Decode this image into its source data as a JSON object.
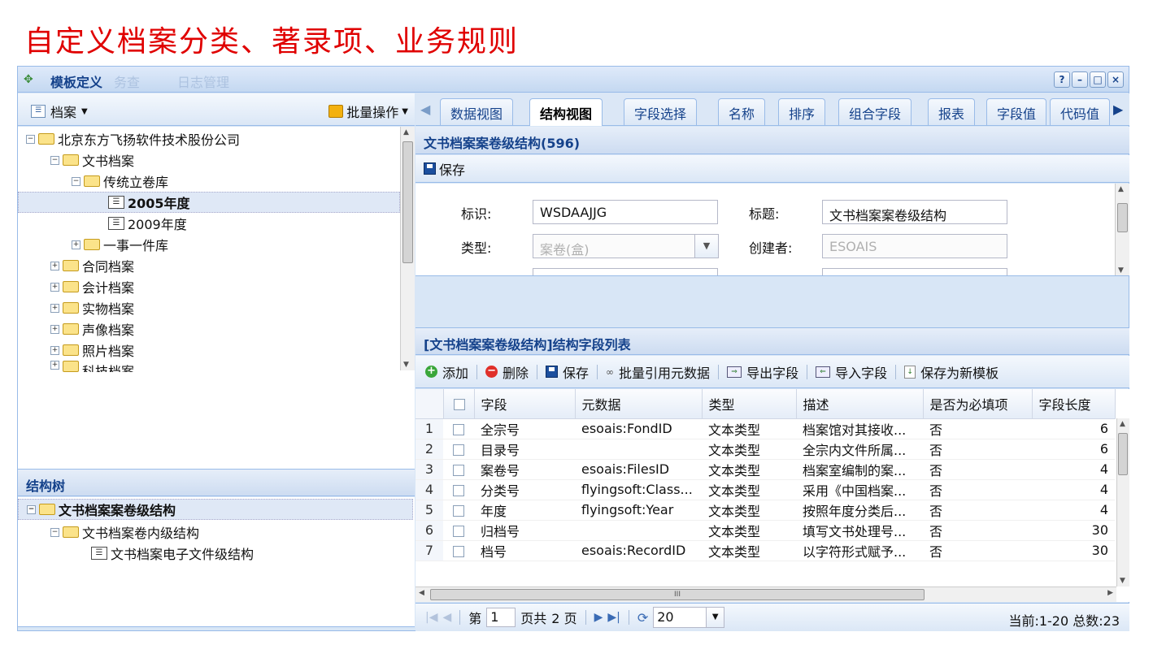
{
  "slide_title": "自定义档案分类、著录项、业务规则",
  "window": {
    "title": "模板定义",
    "ghost_left": "务查",
    "ghost_right": "日志管理",
    "tool_buttons": [
      "?",
      "–",
      "□",
      "×"
    ]
  },
  "left_panel": {
    "dropdown_label": "档案",
    "batch_label": "批量操作",
    "tree": [
      {
        "label": "北京东方飞扬软件技术股份公司",
        "level": 0,
        "type": "folder",
        "state": "open"
      },
      {
        "label": "文书档案",
        "level": 1,
        "type": "folder",
        "state": "open"
      },
      {
        "label": "传统立卷库",
        "level": 2,
        "type": "folder",
        "state": "open"
      },
      {
        "label": "2005年度",
        "level": 3,
        "type": "leaf",
        "selected": true
      },
      {
        "label": "2009年度",
        "level": 3,
        "type": "leaf"
      },
      {
        "label": "一事一件库",
        "level": 2,
        "type": "folder",
        "state": "closed"
      },
      {
        "label": "合同档案",
        "level": 1,
        "type": "folder",
        "state": "closed"
      },
      {
        "label": "会计档案",
        "level": 1,
        "type": "folder",
        "state": "closed"
      },
      {
        "label": "实物档案",
        "level": 1,
        "type": "folder",
        "state": "closed"
      },
      {
        "label": "声像档案",
        "level": 1,
        "type": "folder",
        "state": "closed"
      },
      {
        "label": "照片档案",
        "level": 1,
        "type": "folder",
        "state": "closed"
      },
      {
        "label": "科技档案",
        "level": 1,
        "type": "folder",
        "state": "closed"
      }
    ],
    "structure_title": "结构树",
    "structure_tree": [
      {
        "label": "文书档案案卷级结构",
        "level": 0,
        "type": "folder",
        "selected": true
      },
      {
        "label": "文书档案卷内级结构",
        "level": 1,
        "type": "folder"
      },
      {
        "label": "文书档案电子文件级结构",
        "level": 2,
        "type": "leaf"
      }
    ]
  },
  "tabs": [
    "数据视图",
    "结构视图",
    "字段选择",
    "名称",
    "排序",
    "组合字段",
    "报表",
    "字段值",
    "代码值"
  ],
  "active_tab": "结构视图",
  "form_panel": {
    "title": "文书档案案卷级结构(596)",
    "save_label": "保存",
    "fields": {
      "id_label": "标识:",
      "id_value": "WSDAAJJG",
      "title_label": "标题:",
      "title_value": "文书档案案卷级结构",
      "type_label": "类型:",
      "type_value": "案卷(盒)",
      "creator_label": "创建者:",
      "creator_value": "ESOAIS"
    }
  },
  "grid_panel": {
    "title": "[文书档案案卷级结构]结构字段列表",
    "toolbar": {
      "add": "添加",
      "delete": "删除",
      "save": "保存",
      "batch_ref": "批量引用元数据",
      "export": "导出字段",
      "import": "导入字段",
      "save_tpl": "保存为新模板"
    },
    "columns": [
      "字段",
      "元数据",
      "类型",
      "描述",
      "是否为必填项",
      "字段长度"
    ],
    "rows": [
      {
        "n": "1",
        "field": "全宗号",
        "meta": "esoais:FondID",
        "type": "文本类型",
        "desc": "档案馆对其接收...",
        "req": "否",
        "len": "6"
      },
      {
        "n": "2",
        "field": "目录号",
        "meta": "",
        "type": "文本类型",
        "desc": "全宗内文件所属...",
        "req": "否",
        "len": "6"
      },
      {
        "n": "3",
        "field": "案卷号",
        "meta": "esoais:FilesID",
        "type": "文本类型",
        "desc": "档案室编制的案...",
        "req": "否",
        "len": "4"
      },
      {
        "n": "4",
        "field": "分类号",
        "meta": "flyingsoft:Class...",
        "type": "文本类型",
        "desc": "采用《中国档案...",
        "req": "否",
        "len": "4"
      },
      {
        "n": "5",
        "field": "年度",
        "meta": "flyingsoft:Year",
        "type": "文本类型",
        "desc": "按照年度分类后...",
        "req": "否",
        "len": "4"
      },
      {
        "n": "6",
        "field": "归档号",
        "meta": "",
        "type": "文本类型",
        "desc": "填写文书处理号...",
        "req": "否",
        "len": "30"
      },
      {
        "n": "7",
        "field": "档号",
        "meta": "esoais:RecordID",
        "type": "文本类型",
        "desc": "以字符形式赋予...",
        "req": "否",
        "len": "30"
      }
    ],
    "hscroll_mark": "III"
  },
  "pager": {
    "page_prefix": "第",
    "page_value": "1",
    "page_suffix": "页共",
    "total_pages": "2 页",
    "page_size": "20",
    "info": "当前:1-20 总数:23"
  }
}
